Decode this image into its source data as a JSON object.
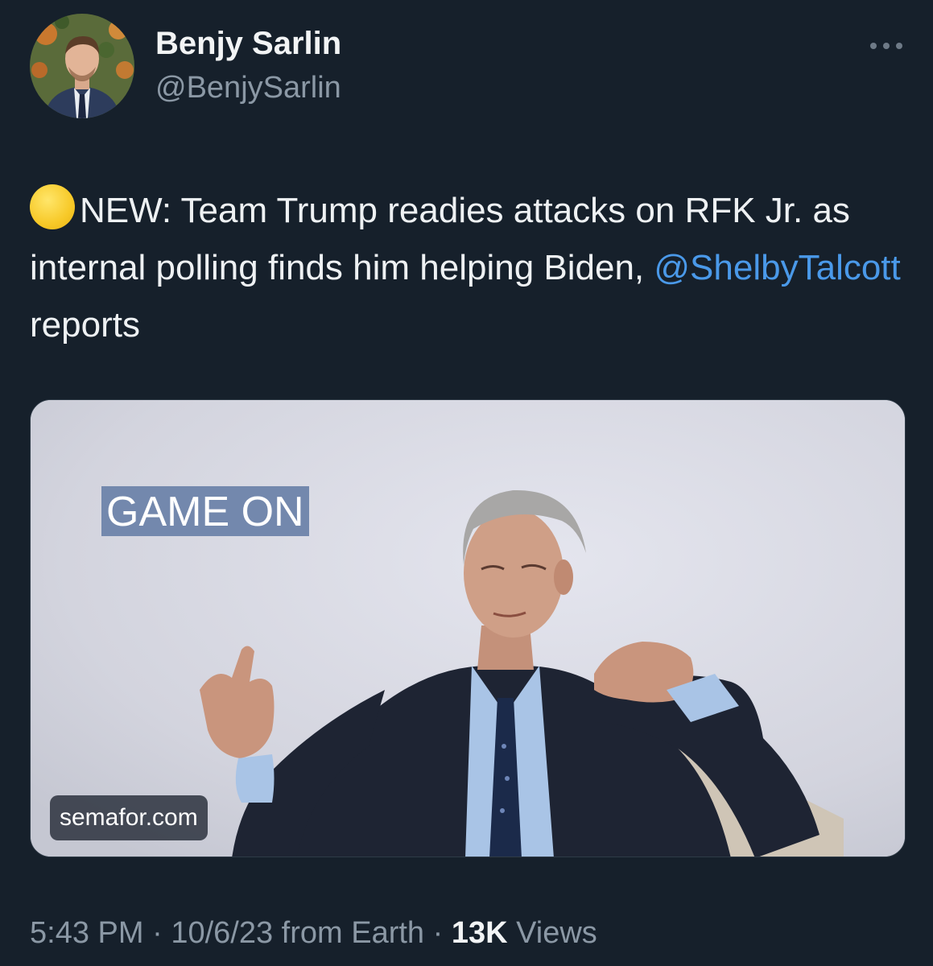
{
  "author": {
    "display_name": "Benjy Sarlin",
    "handle": "@BenjySarlin"
  },
  "more_icon": "more-horizontal-icon",
  "tweet": {
    "emoji": "yellow-circle-icon",
    "text_before": "NEW: Team Trump readies attacks on RFK Jr. as internal polling finds him helping Biden,",
    "mention": "@ShelbyTalcott",
    "text_after": "reports"
  },
  "link_card": {
    "overlay_title": "GAME ON",
    "domain": "semafor.com"
  },
  "meta": {
    "time": "5:43 PM",
    "date": "10/6/23",
    "source": "from Earth",
    "views_count": "13K",
    "views_label": "Views",
    "separator": "·"
  },
  "colors": {
    "background": "#16202b",
    "link": "#4a99e9",
    "secondary_text": "#8b98a5"
  }
}
